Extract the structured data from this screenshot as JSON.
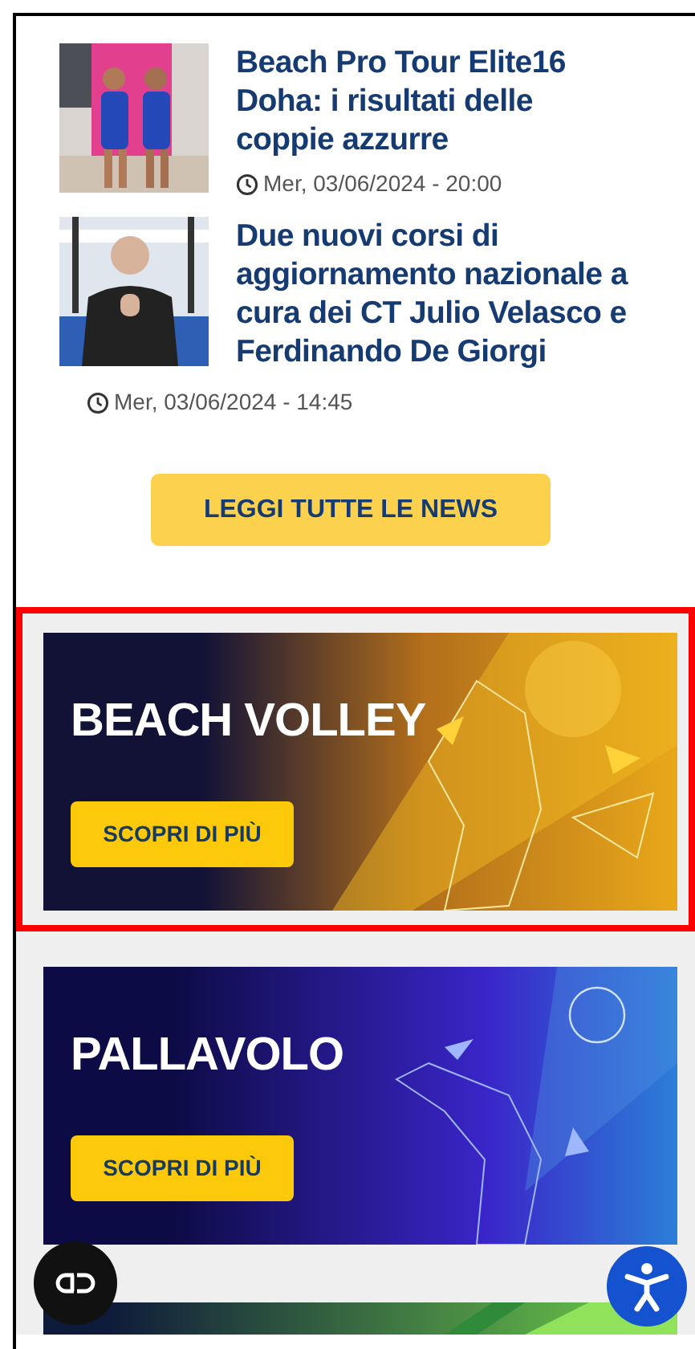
{
  "news": [
    {
      "title": "Beach Pro Tour Elite16 Doha: i risultati delle coppie azzurre",
      "date": "Mer, 03/06/2024 - 20:00",
      "date_below_picture": false
    },
    {
      "title": "Due nuovi corsi di aggiornamento nazionale a cura dei CT Julio Velasco e Ferdinando De Giorgi",
      "date": "Mer, 03/06/2024 - 14:45",
      "date_below_picture": true
    }
  ],
  "all_news_button": "LEGGI TUTTE LE NEWS",
  "banners": [
    {
      "kind": "beach",
      "title": "BEACH VOLLEY",
      "button": "SCOPRI DI PIÙ",
      "highlighted": true
    },
    {
      "kind": "indoor",
      "title": "PALLAVOLO",
      "button": "SCOPRI DI PIÙ",
      "highlighted": false
    },
    {
      "kind": "partial"
    }
  ]
}
